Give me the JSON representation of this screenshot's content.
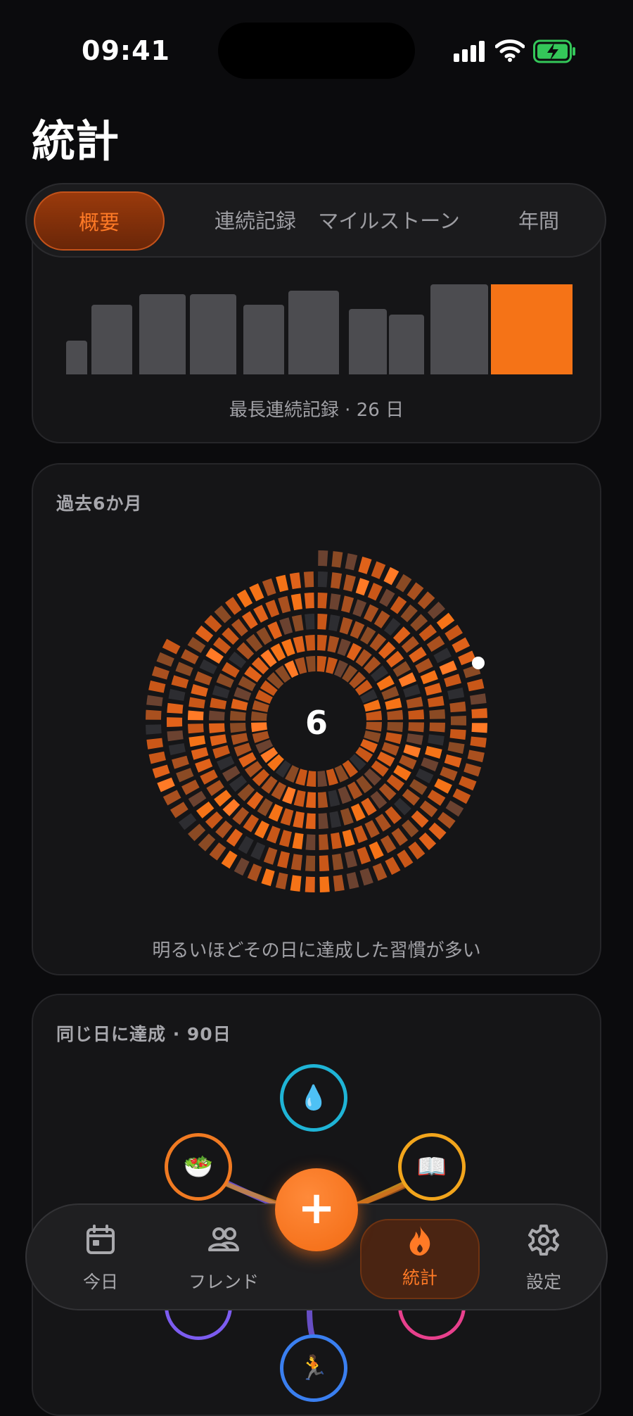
{
  "status": {
    "time": "09:41"
  },
  "page": {
    "title": "統計"
  },
  "tabs": [
    {
      "label": "概要",
      "active": true
    },
    {
      "label": "連続記録"
    },
    {
      "label": "マイルストーン"
    },
    {
      "label": "年間"
    }
  ],
  "streak_card": {
    "caption": "最長連続記録 · 26 日",
    "bar_heights_relative": [
      0.32,
      0.66,
      0.76,
      0.76,
      0.66,
      0.79,
      0.62,
      0.57,
      0.85,
      0.85
    ],
    "highlight_index": 9
  },
  "heatmap_card": {
    "title": "過去6か月",
    "center_value": "6",
    "caption": "明るいほどその日に達成した習慣が多い"
  },
  "cooccur_card": {
    "title": "同じ日に達成 · 90日",
    "habits": [
      {
        "icon": "💧",
        "icon_name": "water-drop-icon",
        "color": "#1fb4d6"
      },
      {
        "icon": "🥗",
        "icon_name": "salad-icon",
        "color": "#f07a22"
      },
      {
        "icon": "📖",
        "icon_name": "book-icon",
        "color": "#f2a51c"
      },
      {
        "icon": "",
        "icon_name": "habit-icon",
        "color": "#7c5cf0"
      },
      {
        "icon": "",
        "icon_name": "habit-icon",
        "color": "#e8408d"
      },
      {
        "icon": "🏃",
        "icon_name": "running-icon",
        "color": "#3a7ff0"
      }
    ]
  },
  "nav": {
    "items": [
      {
        "label": "今日",
        "icon": "calendar-icon"
      },
      {
        "label": "フレンド",
        "icon": "friends-icon"
      },
      {
        "label": "統計",
        "icon": "flame-icon",
        "active": true
      },
      {
        "label": "設定",
        "icon": "gear-icon"
      }
    ],
    "fab_label": "+"
  },
  "colors": {
    "accent": "#f57317",
    "background": "#0b0b0d",
    "card": "#151517"
  }
}
